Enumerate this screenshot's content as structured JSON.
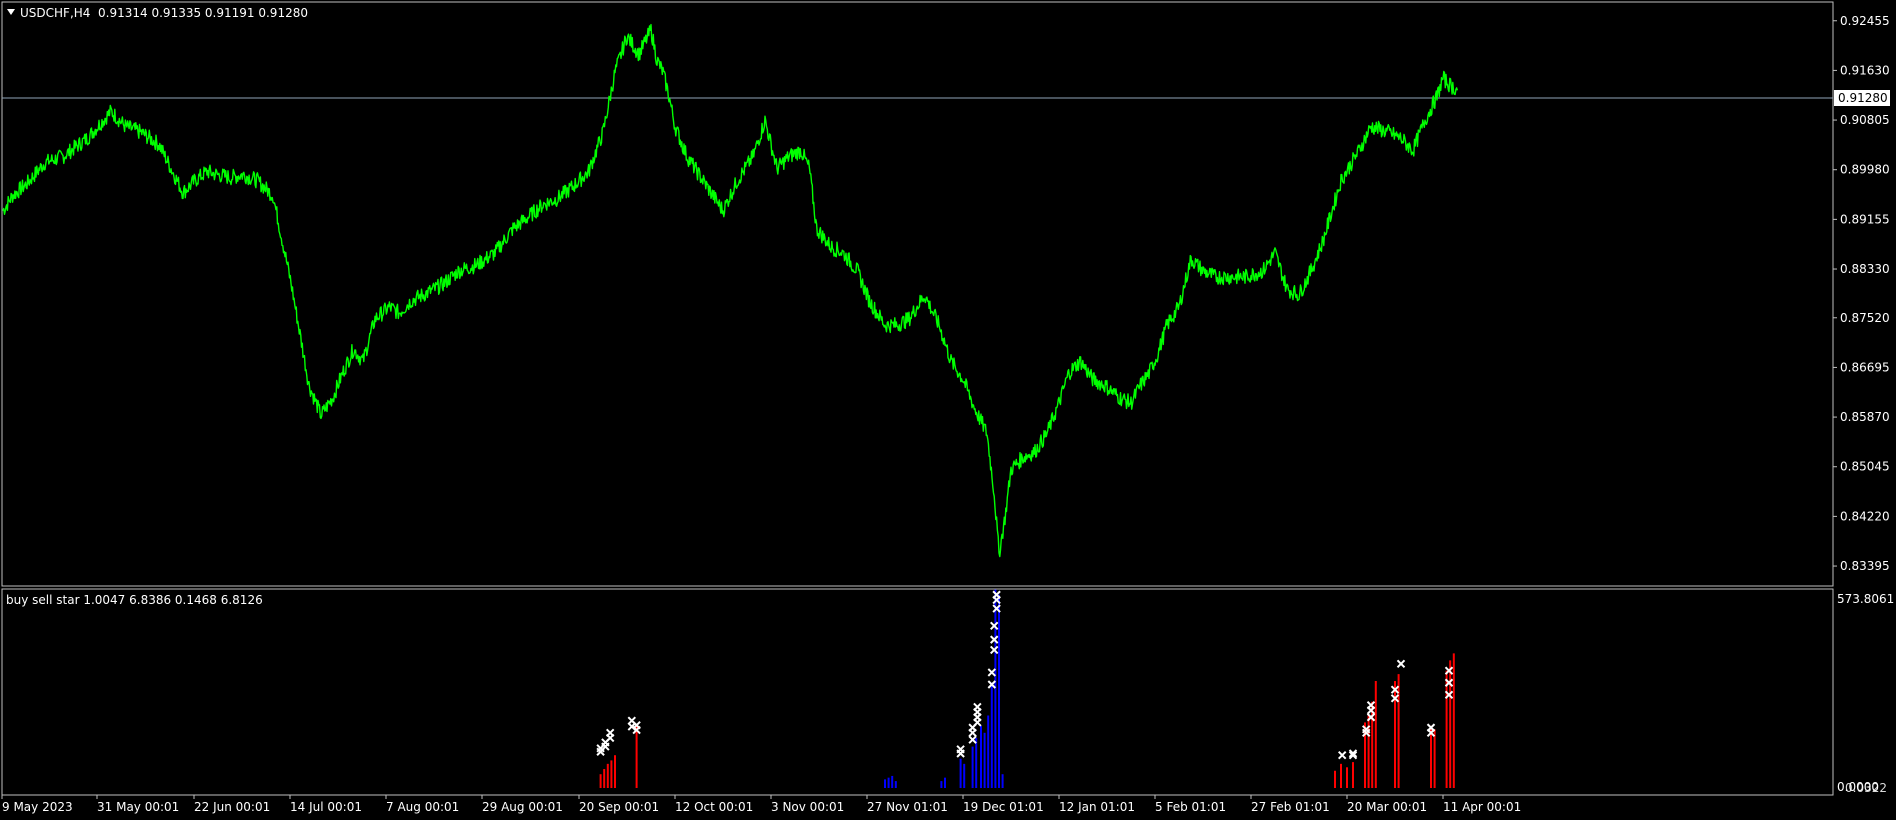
{
  "chart_data": [
    {
      "type": "line",
      "title": "USDCHF,H4  0.91314 0.91335 0.91191 0.91280",
      "symbol": "USDCHF,H4",
      "ohlc": {
        "open": 0.91314,
        "high": 0.91335,
        "low": 0.91191,
        "close": 0.9128
      },
      "current_price_label": "0.91280",
      "y_ticks": [
        "0.92455",
        "0.91630",
        "0.90805",
        "0.89980",
        "0.89155",
        "0.88330",
        "0.87520",
        "0.86695",
        "0.85870",
        "0.85045",
        "0.84220",
        "0.83395"
      ],
      "ylim": [
        0.8308,
        0.9275
      ],
      "x_ticks": [
        "9 May 2023",
        "31 May 00:01",
        "22 Jun 00:01",
        "14 Jul 00:01",
        "7 Aug 00:01",
        "29 Aug 00:01",
        "20 Sep 00:01",
        "12 Oct 00:01",
        "3 Nov 00:01",
        "27 Nov 01:01",
        "19 Dec 01:01",
        "12 Jan 01:01",
        "5 Feb 01:01",
        "27 Feb 01:01",
        "20 Mar 00:01",
        "11 Apr 00:01"
      ],
      "series": [
        {
          "color": "#00ff00",
          "x": [
            0,
            8,
            20,
            35,
            50,
            70,
            90,
            102,
            115,
            130,
            140,
            150,
            160,
            170,
            178,
            190,
            200,
            212,
            225,
            240,
            255,
            265,
            275,
            283,
            292,
            300,
            310,
            322,
            330,
            340,
            350,
            360,
            368,
            380,
            395,
            410,
            425,
            438,
            450,
            462,
            475,
            488,
            500,
            510,
            520,
            530,
            540,
            545,
            550,
            555,
            560,
            570,
            580,
            590,
            600,
            612,
            625,
            635,
            645,
            655,
            665,
            672,
            678,
            690,
            700,
            712,
            722,
            735,
            745,
            755,
            768,
            780,
            790,
            800,
            810,
            820,
            826,
            830,
            835,
            840,
            850,
            860,
            870,
            880,
            888,
            898,
            908,
            918,
            930,
            940,
            948,
            955,
            962,
            970,
            980,
            990,
            1000,
            1010,
            1020,
            1035,
            1050,
            1060,
            1070,
            1080,
            1090,
            1100,
            1115,
            1130,
            1140,
            1155,
            1165,
            1175,
            1185,
            1195,
            1200,
            1205,
            1212
          ],
          "values": [
            0.893,
            0.8955,
            0.8975,
            0.901,
            0.902,
            0.905,
            0.9095,
            0.907,
            0.906,
            0.904,
            0.9,
            0.896,
            0.898,
            0.8995,
            0.899,
            0.8985,
            0.899,
            0.898,
            0.8955,
            0.881,
            0.864,
            0.859,
            0.862,
            0.866,
            0.87,
            0.868,
            0.875,
            0.877,
            0.876,
            0.878,
            0.879,
            0.88,
            0.881,
            0.883,
            0.884,
            0.886,
            0.89,
            0.892,
            0.894,
            0.895,
            0.897,
            0.8995,
            0.906,
            0.916,
            0.922,
            0.919,
            0.923,
            0.918,
            0.916,
            0.912,
            0.907,
            0.902,
            0.899,
            0.896,
            0.893,
            0.898,
            0.902,
            0.908,
            0.9,
            0.902,
            0.903,
            0.9,
            0.89,
            0.887,
            0.886,
            0.883,
            0.878,
            0.874,
            0.874,
            0.875,
            0.879,
            0.874,
            0.868,
            0.865,
            0.86,
            0.856,
            0.846,
            0.836,
            0.842,
            0.85,
            0.852,
            0.853,
            0.856,
            0.861,
            0.866,
            0.868,
            0.865,
            0.864,
            0.862,
            0.861,
            0.864,
            0.866,
            0.869,
            0.874,
            0.877,
            0.885,
            0.883,
            0.882,
            0.882,
            0.882,
            0.883,
            0.886,
            0.88,
            0.879,
            0.883,
            0.888,
            0.898,
            0.903,
            0.907,
            0.906,
            0.905,
            0.903,
            0.908,
            0.912,
            0.915,
            0.914,
            0.913
          ]
        }
      ]
    },
    {
      "type": "bar",
      "title": "buy sell star 1.0047 6.8386 0.1468 6.8126",
      "y_ticks": [
        "573.8061",
        "0.0000"
      ],
      "y_tick_bottom_overlap": "0.0322",
      "ylim": [
        0,
        573.8061
      ],
      "series": [
        {
          "name": "red",
          "color": "#ff0000",
          "x": [
            498,
            501,
            504,
            507,
            510,
            528,
            1110,
            1115,
            1120,
            1125,
            1135,
            1138,
            1141,
            1144,
            1160,
            1163,
            1190,
            1193,
            1203,
            1206,
            1209
          ],
          "values": [
            40,
            55,
            70,
            80,
            95,
            185,
            50,
            70,
            60,
            75,
            190,
            210,
            250,
            310,
            310,
            330,
            180,
            170,
            340,
            370,
            390
          ]
        },
        {
          "name": "blue",
          "color": "#0000ff",
          "x": [
            735,
            738,
            741,
            744,
            782,
            785,
            798,
            801,
            808,
            811,
            815,
            818,
            821,
            824,
            827,
            830,
            833
          ],
          "values": [
            25,
            30,
            35,
            20,
            20,
            30,
            85,
            70,
            120,
            145,
            180,
            160,
            210,
            305,
            575,
            560,
            40
          ]
        }
      ],
      "star_markers": [
        {
          "x": 498,
          "values": [
            105,
            115
          ]
        },
        {
          "x": 502,
          "values": [
            120,
            132
          ]
        },
        {
          "x": 506,
          "values": [
            145,
            160
          ]
        },
        {
          "x": 524,
          "values": [
            178,
            195
          ]
        },
        {
          "x": 528,
          "values": [
            168,
            182
          ]
        },
        {
          "x": 798,
          "values": [
            100,
            112
          ]
        },
        {
          "x": 808,
          "values": [
            140,
            160,
            175
          ]
        },
        {
          "x": 812,
          "values": [
            190,
            205,
            220,
            235
          ]
        },
        {
          "x": 824,
          "values": [
            300,
            335
          ]
        },
        {
          "x": 826,
          "values": [
            400,
            430,
            470
          ]
        },
        {
          "x": 828,
          "values": [
            520,
            545,
            560
          ]
        },
        {
          "x": 1116,
          "values": [
            95
          ]
        },
        {
          "x": 1125,
          "values": [
            95,
            100
          ]
        },
        {
          "x": 1136,
          "values": [
            160,
            170
          ]
        },
        {
          "x": 1140,
          "values": [
            205,
            225,
            240
          ]
        },
        {
          "x": 1160,
          "values": [
            260,
            285
          ]
        },
        {
          "x": 1165,
          "values": [
            360
          ]
        },
        {
          "x": 1190,
          "values": [
            160,
            175
          ]
        },
        {
          "x": 1205,
          "values": [
            270,
            305,
            340
          ]
        }
      ]
    }
  ]
}
